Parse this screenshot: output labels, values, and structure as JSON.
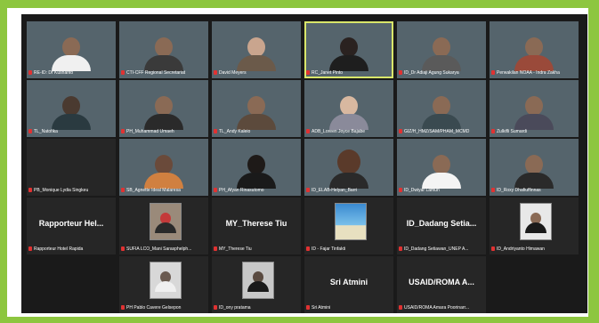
{
  "gallery": {
    "tiles": [
      {
        "label": "RE-ID: Dr Kusnanto",
        "center": ""
      },
      {
        "label": "CTI-CFF Regional Secretariat",
        "center": ""
      },
      {
        "label": "David Meyers",
        "center": ""
      },
      {
        "label": "RC_Janet Pinto",
        "center": ""
      },
      {
        "label": "ID_Dr Adiaji Agung Sukarya",
        "center": ""
      },
      {
        "label": "Perwakilan NOAA - Indra Zakha",
        "center": ""
      },
      {
        "label": "TL_Natofika",
        "center": ""
      },
      {
        "label": "PH_Muhammad Umaeh",
        "center": ""
      },
      {
        "label": "TL_Andy Kaleio",
        "center": ""
      },
      {
        "label": "ADB_Loreen Joyce Bajabe",
        "center": ""
      },
      {
        "label": "GIZ/H_HMZ/SAM/PHAM_MCMD",
        "center": ""
      },
      {
        "label": "Zulkifli Sumardi",
        "center": ""
      },
      {
        "label": "PB_Monique Lydia Singkeu",
        "center": ""
      },
      {
        "label": "SB_Agnette Ideal Malaresa",
        "center": ""
      },
      {
        "label": "PH_Afyan Rinasutomo",
        "center": ""
      },
      {
        "label": "ID_ELAB-Helyan_Barri",
        "center": ""
      },
      {
        "label": "ID_Dwiyar Lamun",
        "center": ""
      },
      {
        "label": "ID_Roxy Dhafiuffinnas",
        "center": ""
      },
      {
        "label": "Rapporteur Hotel Rapida",
        "center": "Rapporteur  Hel..."
      },
      {
        "label": "SUFIA LCO_Mani Sarasphelph...",
        "center": ""
      },
      {
        "label": "MY_Therese Tiu",
        "center": "MY_Therese Tiu"
      },
      {
        "label": "ID - Fajar Tinfakti",
        "center": ""
      },
      {
        "label": "ID_Dadang Setiawan_UNEP A...",
        "center": "ID_Dadang  Setia..."
      },
      {
        "label": "ID_Andriyanto Himawan",
        "center": ""
      },
      {
        "label": "PH Pablo Cavere Gelsepon",
        "center": ""
      },
      {
        "label": "ID_ony pratama",
        "center": ""
      },
      {
        "label": "Sri Atmini",
        "center": "Sri Atmini"
      },
      {
        "label": "USAID/ROMA Amara Poorinarr...",
        "center": "USAID/ROMA  A..."
      }
    ]
  },
  "colors": {
    "outer_border": "#8dc63f",
    "screen_bg": "#1a1a1a",
    "active_speaker": "#d9e66a",
    "muted_mic": "#e03232"
  }
}
